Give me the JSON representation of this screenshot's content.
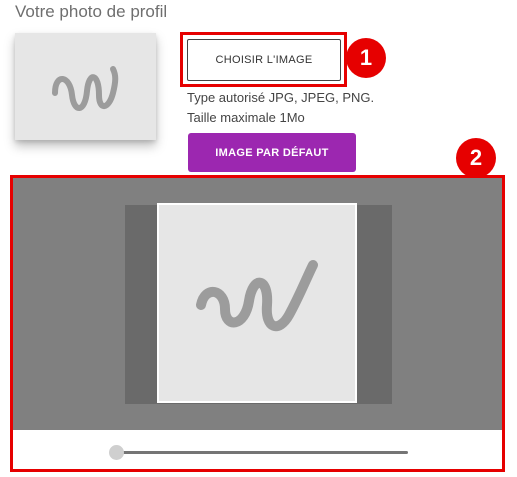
{
  "profile_photo": {
    "title": "Votre photo de profil",
    "avatar_icon": "signature-placeholder-icon"
  },
  "upload": {
    "choose_label": "CHOISIR L'IMAGE",
    "allowed_types": "Type autorisé JPG, JPEG, PNG.",
    "max_size": "Taille maximale 1Mo",
    "default_label": "IMAGE PAR DÉFAUT"
  },
  "annotations": {
    "badge_1": "1",
    "badge_2": "2"
  },
  "cropper": {
    "image_icon": "signature-placeholder-icon",
    "zoom_level": 0
  },
  "colors": {
    "highlight": "#e60000",
    "default_button": "#9c27b0",
    "cropper_background": "#808080"
  }
}
